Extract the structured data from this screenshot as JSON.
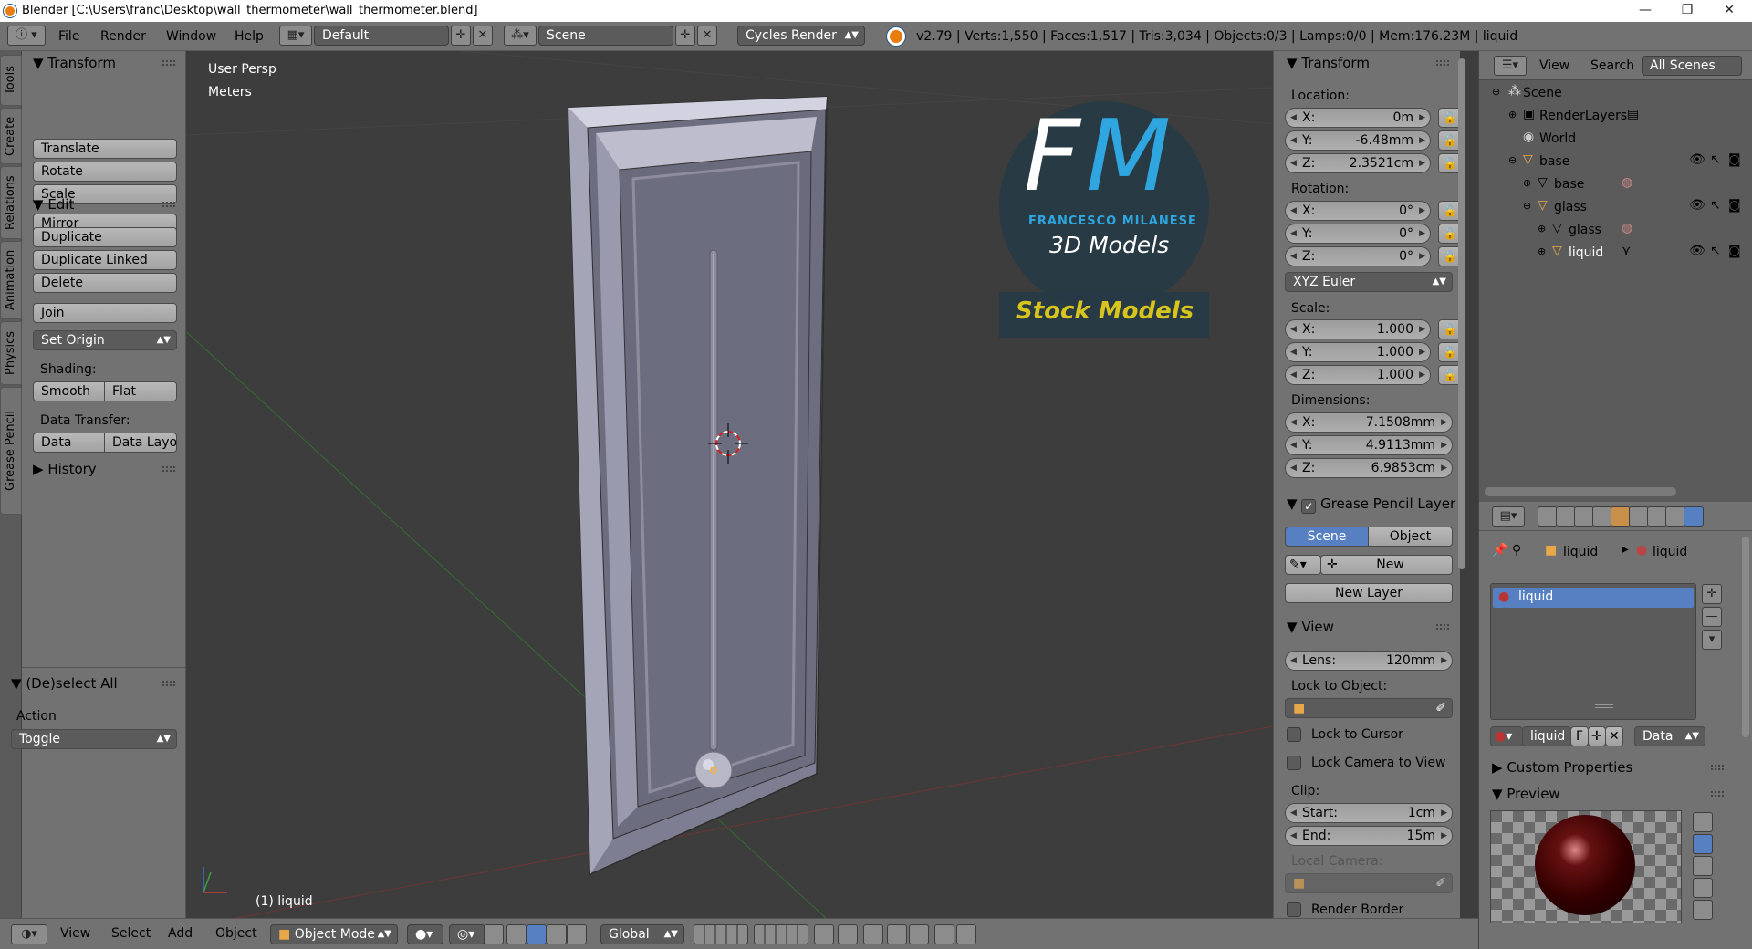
{
  "window": {
    "title": "Blender [C:\\Users\\franc\\Desktop\\wall_thermometer\\wall_thermometer.blend]",
    "minimize": "—",
    "maximize": "❐",
    "close": "✕"
  },
  "info_header": {
    "menu": [
      "File",
      "Render",
      "Window",
      "Help"
    ],
    "screen_layout": "Default",
    "scene": "Scene",
    "render_engine": "Cycles Render",
    "stats": "v2.79 | Verts:1,550 | Faces:1,517 | Tris:3,034 | Objects:0/3 | Lamps:0/0 | Mem:176.23M | liquid"
  },
  "tool_tabs": [
    "Tools",
    "Create",
    "Relations",
    "Animation",
    "Physics",
    "Grease Pencil"
  ],
  "toolshelf": {
    "transform_title": "Transform",
    "translate": "Translate",
    "rotate": "Rotate",
    "scale": "Scale",
    "mirror": "Mirror",
    "edit_title": "Edit",
    "duplicate": "Duplicate",
    "duplicate_linked": "Duplicate Linked",
    "delete": "Delete",
    "join": "Join",
    "set_origin": "Set Origin",
    "shading_label": "Shading:",
    "smooth": "Smooth",
    "flat": "Flat",
    "data_transfer_label": "Data Transfer:",
    "data": "Data",
    "data_layout": "Data Layo",
    "history_title": "History",
    "operator_title": "(De)select All",
    "action_label": "Action",
    "action_value": "Toggle"
  },
  "viewport": {
    "view_name": "User Persp",
    "units": "Meters",
    "active_object": "(1) liquid",
    "watermark": {
      "initials_f": "F",
      "initials_m": "M",
      "author": "FRANCESCO MILANESE",
      "subtitle": "3D Models",
      "banner": "Stock Models"
    }
  },
  "npanel": {
    "transform_title": "Transform",
    "location_label": "Location:",
    "location": {
      "x": "0m",
      "y": "-6.48mm",
      "z": "2.3521cm"
    },
    "rotation_label": "Rotation:",
    "rotation": {
      "x": "0°",
      "y": "0°",
      "z": "0°"
    },
    "rotation_mode": "XYZ Euler",
    "scale_label": "Scale:",
    "scale": {
      "x": "1.000",
      "y": "1.000",
      "z": "1.000"
    },
    "dimensions_label": "Dimensions:",
    "dimensions": {
      "x": "7.1508mm",
      "y": "4.9113mm",
      "z": "6.9853cm"
    },
    "axis": {
      "x": "X:",
      "y": "Y:",
      "z": "Z:"
    },
    "gp_title": "Grease Pencil Layer",
    "gp_scene": "Scene",
    "gp_object": "Object",
    "gp_new": "New",
    "gp_new_layer": "New Layer",
    "view_title": "View",
    "lens_label": "Lens:",
    "lens_value": "120mm",
    "lock_to_object": "Lock to Object:",
    "lock_to_cursor": "Lock to Cursor",
    "lock_camera": "Lock Camera to View",
    "clip_label": "Clip:",
    "clip_start_label": "Start:",
    "clip_start": "1cm",
    "clip_end_label": "End:",
    "clip_end": "15m",
    "local_camera": "Local Camera:",
    "render_border": "Render Border"
  },
  "outliner": {
    "view": "View",
    "search": "Search",
    "filter": "All Scenes",
    "items": [
      "Scene",
      "RenderLayers",
      "World",
      "base",
      "base",
      "glass",
      "glass",
      "liquid"
    ]
  },
  "properties": {
    "crumb_object": "liquid",
    "crumb_material": "liquid",
    "slot_name": "liquid",
    "material_name": "liquid",
    "fake_user": "F",
    "link": "Data",
    "custom_properties": "Custom Properties",
    "preview": "Preview"
  },
  "bottom_header": {
    "menu": [
      "View",
      "Select",
      "Add",
      "Object"
    ],
    "mode": "Object Mode",
    "orientation": "Global"
  },
  "colors": {
    "panel": "#727272",
    "field": "#5b5b5b",
    "viewport": "#3d3d3d",
    "selected": "#5680c2",
    "highlight": "#ffaf29",
    "watermark_blue": "#2fa6e0",
    "watermark_yellow": "#d7c51d"
  }
}
